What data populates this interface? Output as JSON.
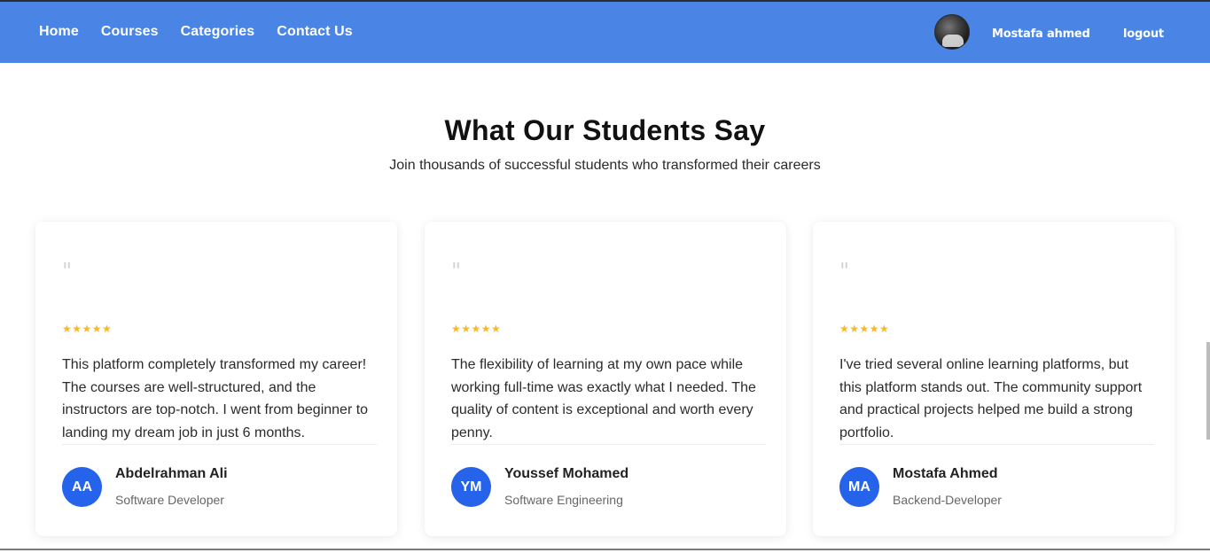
{
  "nav": {
    "links": [
      "Home",
      "Courses",
      "Categories",
      "Contact Us"
    ],
    "user_name": "Mostafa ahmed",
    "logout_label": "logout",
    "colors": {
      "bar": "#4a85e6"
    }
  },
  "section": {
    "title": "What Our Students Say",
    "subtitle": "Join thousands of successful students who transformed their careers"
  },
  "testimonials": [
    {
      "quote_mark": "\"",
      "rating": 5,
      "stars": "★★★★★",
      "text": "This platform completely transformed my career! The courses are well-structured, and the instructors are top-notch. I went from beginner to landing my dream job in just 6 months.",
      "initials": "AA",
      "name": "Abdelrahman Ali",
      "role": "Software Developer"
    },
    {
      "quote_mark": "\"",
      "rating": 5,
      "stars": "★★★★★",
      "text": "The flexibility of learning at my own pace while working full-time was exactly what I needed. The quality of content is exceptional and worth every penny.",
      "initials": "YM",
      "name": "Youssef Mohamed",
      "role": "Software Engineering"
    },
    {
      "quote_mark": "\"",
      "rating": 5,
      "stars": "★★★★★",
      "text": "I've tried several online learning platforms, but this platform stands out. The community support and practical projects helped me build a strong portfolio.",
      "initials": "MA",
      "name": "Mostafa Ahmed",
      "role": "Backend-Developer"
    }
  ]
}
